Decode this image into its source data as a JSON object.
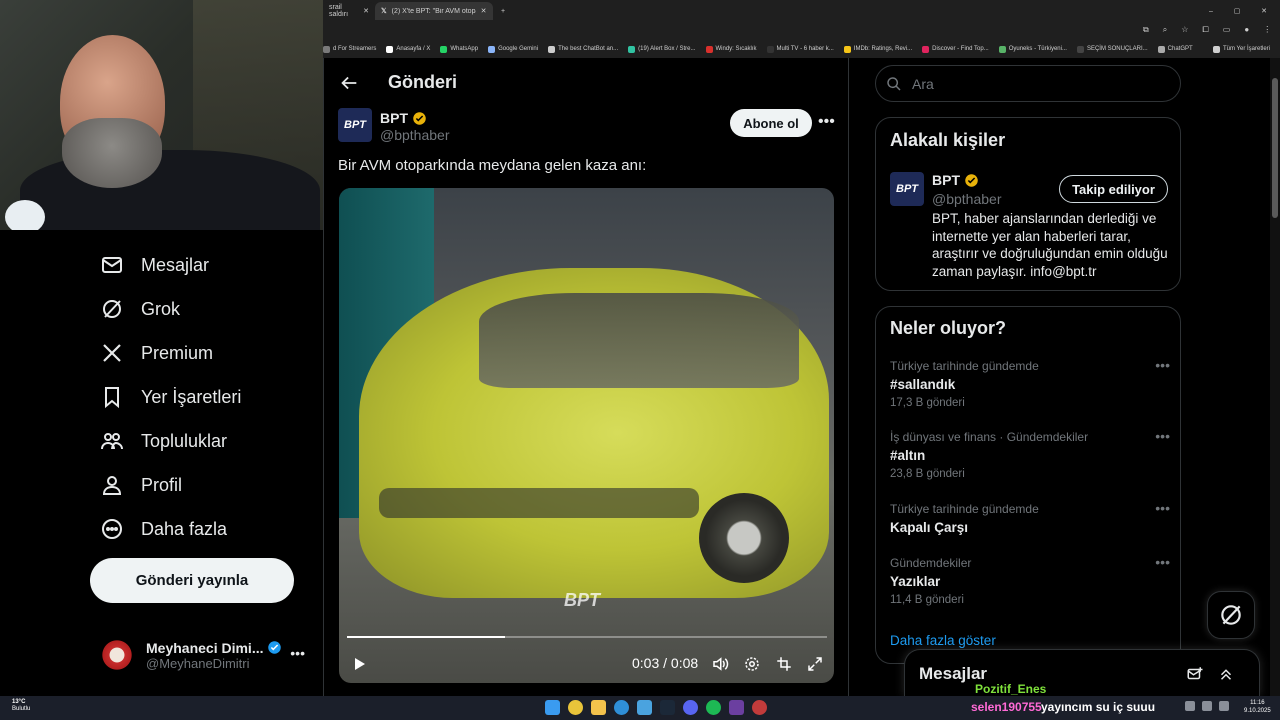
{
  "browser": {
    "tabs": [
      {
        "label": "srail saldırı"
      },
      {
        "label": "(2) X'te BPT: \"Bir AVM otoparkı...\""
      }
    ],
    "bookmarks": [
      {
        "label": "d For Streamers",
        "color": "#7a7a7a"
      },
      {
        "label": "Anasayfa / X",
        "color": "#ffffff"
      },
      {
        "label": "WhatsApp",
        "color": "#25d366"
      },
      {
        "label": "Google Gemini",
        "color": "#8ab4f8"
      },
      {
        "label": "The best ChatBot an...",
        "color": "#cccccc"
      },
      {
        "label": "(19) Alert Box / Stre...",
        "color": "#31c3a2"
      },
      {
        "label": "Windy: Sıcaklık",
        "color": "#d9302c"
      },
      {
        "label": "Multi TV - 6 haber k...",
        "color": "#333333"
      },
      {
        "label": "IMDb: Ratings, Revi...",
        "color": "#f5c518"
      },
      {
        "label": "Discover - Find Top...",
        "color": "#e0245e"
      },
      {
        "label": "Oyuneks - Türkiyeni...",
        "color": "#58b368"
      },
      {
        "label": "SEÇİM SONUÇLARI...",
        "color": "#444444"
      },
      {
        "label": "ChatGPT",
        "color": "#aaaaaa"
      },
      {
        "label": "Tüm Yer İşaretleri",
        "color": "#cfcfcf"
      }
    ]
  },
  "nav": {
    "items": [
      {
        "label": "Mesajlar",
        "icon": "envelope-icon"
      },
      {
        "label": "Grok",
        "icon": "grok-icon"
      },
      {
        "label": "Premium",
        "icon": "x-logo-icon"
      },
      {
        "label": "Yer İşaretleri",
        "icon": "bookmark-icon"
      },
      {
        "label": "Topluluklar",
        "icon": "communities-icon"
      },
      {
        "label": "Profil",
        "icon": "profile-icon"
      },
      {
        "label": "Daha fazla",
        "icon": "more-circle-icon"
      }
    ],
    "post_button": "Gönderi yayınla",
    "account": {
      "display_name": "Meyhaneci Dimi...",
      "username": "@MeyhaneDimitri"
    }
  },
  "post": {
    "header_title": "Gönderi",
    "author": {
      "display_name": "BPT",
      "username": "@bpthaber",
      "logo_text": "BPT"
    },
    "subscribe_button": "Abone ol",
    "text": "Bir AVM otoparkında meydana gelen kaza anı:",
    "video": {
      "watermark": "BPT",
      "time": "0:03 / 0:08",
      "progress": 0.33
    }
  },
  "sidebar": {
    "search_placeholder": "Ara",
    "related": {
      "title": "Alakalı kişiler",
      "name": "BPT",
      "username": "@bpthaber",
      "follow_button": "Takip ediliyor",
      "bio": "BPT, haber ajanslarından derlediği ve internette yer alan haberleri tarar, araştırır ve doğruluğundan emin olduğu zaman paylaşır. info@bpt.tr"
    },
    "trends": {
      "title": "Neler oluyor?",
      "items": [
        {
          "context": "Türkiye tarihinde gündemde",
          "name": "#sallandık",
          "count": "17,3 B gönderi"
        },
        {
          "context": "İş dünyası ve finans · Gündemdekiler",
          "name": "#altın",
          "count": "23,8 B gönderi"
        },
        {
          "context": "Türkiye tarihinde gündemde",
          "name": "Kapalı Çarşı",
          "count": ""
        },
        {
          "context": "Gündemdekiler",
          "name": "Yazıklar",
          "count": "11,4 B gönderi"
        }
      ],
      "show_more": "Daha fazla göster"
    },
    "messages_drawer": "Mesajlar"
  },
  "stream": {
    "overlay_user1": "Pozitif_Enes",
    "overlay_user2": "selen190755",
    "overlay_message": "yayıncım su iç suuu"
  },
  "taskbar": {
    "weather_temp": "13°C",
    "weather_desc": "Bulutlu",
    "time": "11:16",
    "date": "9.10.2025"
  },
  "colors": {
    "accent": "#1d9bf0",
    "verified": "#e8b20a",
    "overlay_green": "#7fe23b",
    "overlay_pink": "#ff6ad5",
    "overlay_yellow": "#fff36a"
  }
}
